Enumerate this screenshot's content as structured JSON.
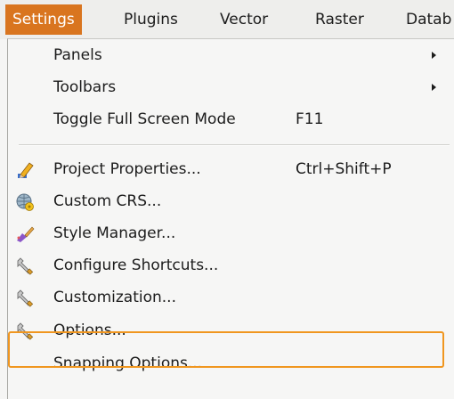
{
  "menubar": {
    "items": [
      {
        "label": "Settings"
      },
      {
        "label": "Plugins"
      },
      {
        "label": "Vector"
      },
      {
        "label": "Raster"
      },
      {
        "label": "Datab"
      }
    ]
  },
  "menu": {
    "items": [
      {
        "label": "Panels",
        "has_submenu": true
      },
      {
        "label": "Toolbars",
        "has_submenu": true
      },
      {
        "label": "Toggle Full Screen Mode",
        "shortcut": "F11"
      },
      {
        "label": "Project Properties...",
        "shortcut": "Ctrl+Shift+P",
        "icon": "pencil-icon"
      },
      {
        "label": "Custom CRS...",
        "icon": "globe-icon"
      },
      {
        "label": "Style Manager...",
        "icon": "paintbrush-icon"
      },
      {
        "label": "Configure Shortcuts...",
        "icon": "wrench-icon"
      },
      {
        "label": "Customization...",
        "icon": "wrench-icon"
      },
      {
        "label": "Options...",
        "icon": "wrench-icon",
        "highlighted": true
      },
      {
        "label": "Snapping Options..."
      }
    ]
  },
  "colors": {
    "active_menu": "#d9751f",
    "highlight_border": "#f0961f"
  }
}
